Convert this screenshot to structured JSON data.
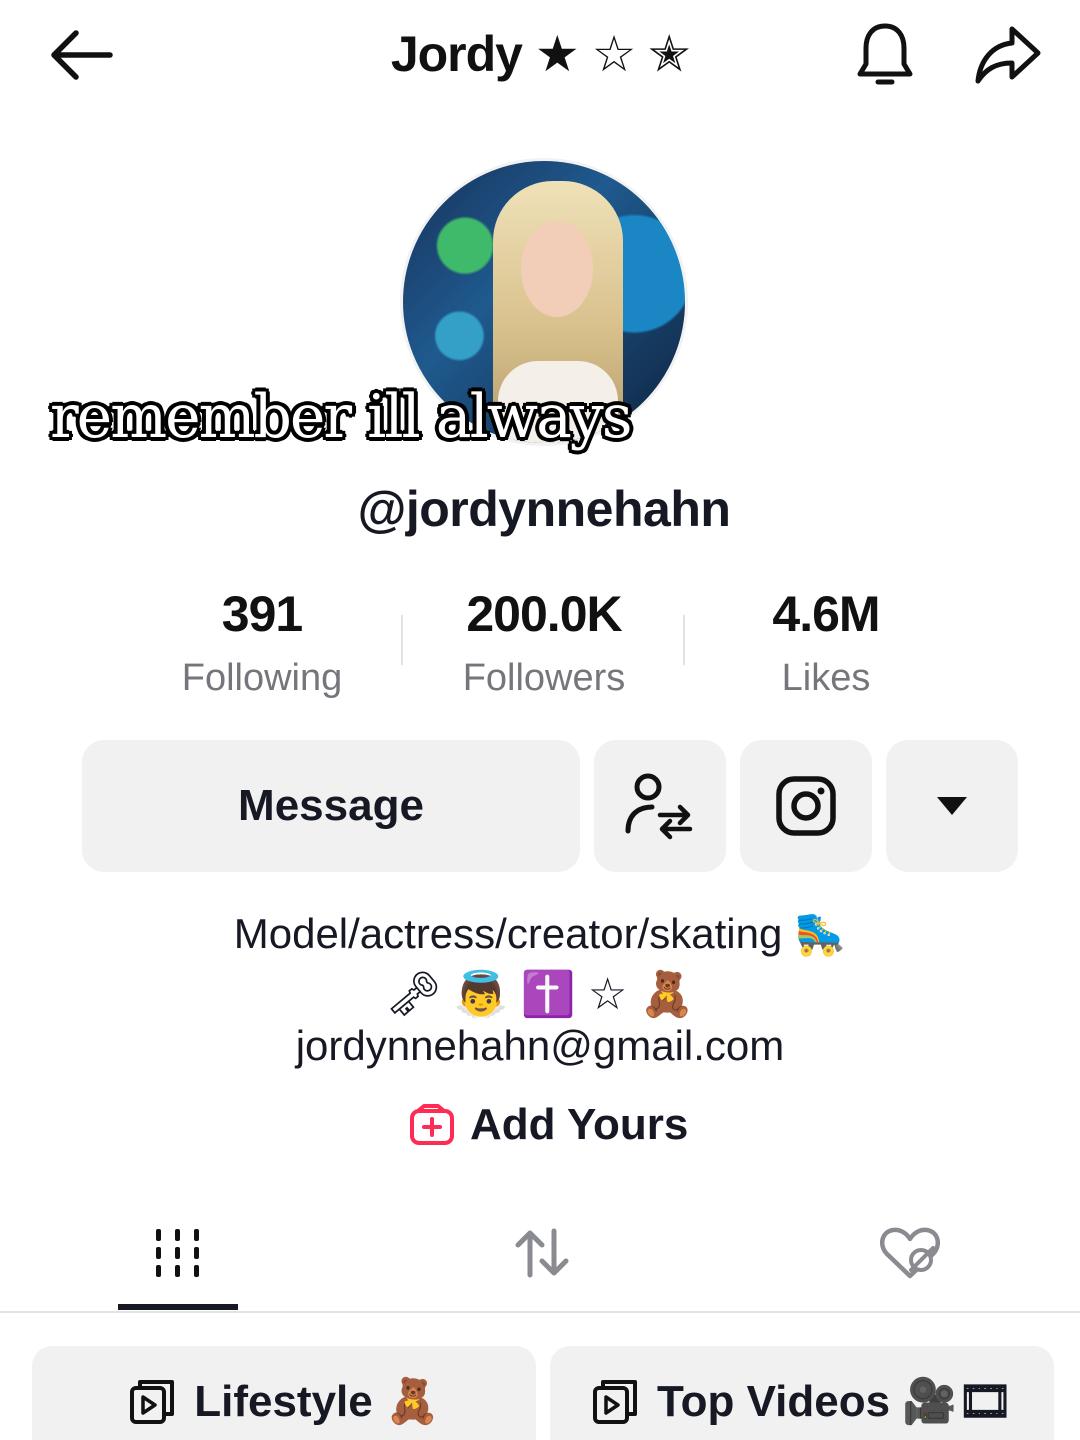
{
  "header": {
    "title": "Jordy ★ ☆ ✭",
    "icons": [
      "back-arrow-icon",
      "bell-icon",
      "share-icon"
    ]
  },
  "overlay": {
    "caption": "remember ill always"
  },
  "profile": {
    "username": "@jordynnehahn"
  },
  "stats": [
    {
      "value": "391",
      "label": "Following"
    },
    {
      "value": "200.0K",
      "label": "Followers"
    },
    {
      "value": "4.6M",
      "label": "Likes"
    }
  ],
  "actions": {
    "message_label": "Message",
    "icons": [
      "add-friend-icon",
      "instagram-icon",
      "dropdown-caret-icon"
    ]
  },
  "bio": {
    "line1": "Model/actress/creator/skating 🛼",
    "line2": "🗝 👼 ✝️ ☆ 🧸",
    "line3": "jordynnehahn@gmail.com"
  },
  "add_yours": {
    "label": "Add Yours"
  },
  "tabs": [
    {
      "name": "videos",
      "active": true
    },
    {
      "name": "reposts",
      "active": false
    },
    {
      "name": "liked",
      "active": false
    }
  ],
  "playlists": [
    {
      "label": "Lifestyle 🧸"
    },
    {
      "label": "Top Videos 🎥🎞"
    }
  ],
  "colors": {
    "text": "#161823",
    "muted": "#75767c",
    "button_bg": "#f1f1f2",
    "accent": "#fe2c55"
  }
}
